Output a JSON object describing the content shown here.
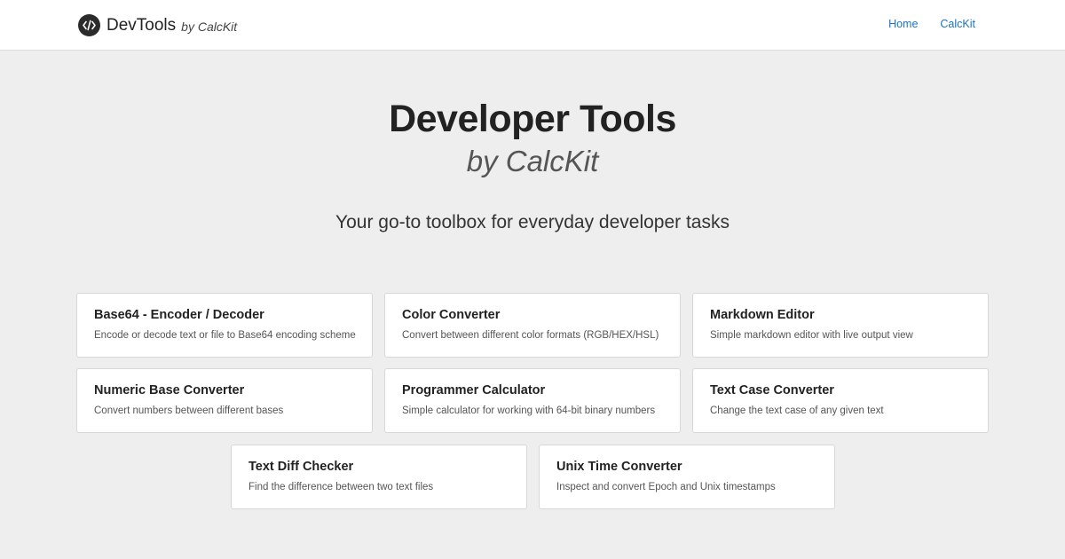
{
  "nav": {
    "brand_name": "DevTools",
    "brand_sub": "by CalcKit",
    "brand_icon": "code-icon",
    "links": [
      "Home",
      "CalcKit"
    ],
    "link_color": "#1a73c9"
  },
  "hero": {
    "title": "Developer Tools",
    "subtitle": "by CalcKit",
    "tagline": "Your go-to toolbox for everyday developer tasks"
  },
  "tools": [
    {
      "title": "Base64 - Encoder / Decoder",
      "desc": "Encode or decode text or file to Base64 encoding scheme"
    },
    {
      "title": "Color Converter",
      "desc": "Convert between different color formats (RGB/HEX/HSL)"
    },
    {
      "title": "Markdown Editor",
      "desc": "Simple markdown editor with live output view"
    },
    {
      "title": "Numeric Base Converter",
      "desc": "Convert numbers between different bases"
    },
    {
      "title": "Programmer Calculator",
      "desc": "Simple calculator for working with 64-bit binary numbers"
    },
    {
      "title": "Text Case Converter",
      "desc": "Change the text case of any given text"
    },
    {
      "title": "Text Diff Checker",
      "desc": "Find the difference between two text files"
    },
    {
      "title": "Unix Time Converter",
      "desc": "Inspect and convert Epoch and Unix timestamps"
    }
  ]
}
